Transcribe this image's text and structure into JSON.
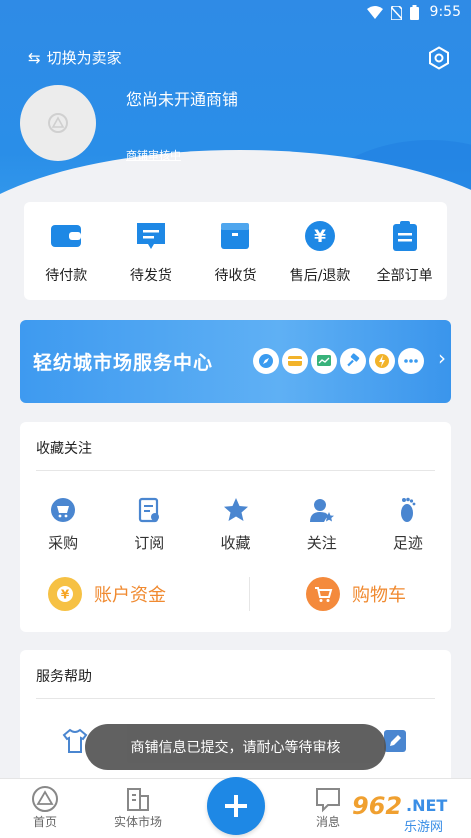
{
  "statusbar": {
    "time": "9:55"
  },
  "header": {
    "switch_label": "切换为卖家",
    "shop_name": "您尚未开通商铺",
    "shop_status": "商铺审核中"
  },
  "orders": [
    {
      "label": "待付款",
      "icon": "wallet-icon"
    },
    {
      "label": "待发货",
      "icon": "message-box-icon"
    },
    {
      "label": "待收货",
      "icon": "box-icon"
    },
    {
      "label": "售后/退款",
      "icon": "yen-icon"
    },
    {
      "label": "全部订单",
      "icon": "clipboard-icon"
    }
  ],
  "banner": {
    "title": "轻纺城市场服务中心"
  },
  "favorites": {
    "title": "收藏关注",
    "items": [
      {
        "label": "采购",
        "icon": "cart-icon"
      },
      {
        "label": "订阅",
        "icon": "subscribe-icon"
      },
      {
        "label": "收藏",
        "icon": "star-icon"
      },
      {
        "label": "关注",
        "icon": "follow-user-icon"
      },
      {
        "label": "足迹",
        "icon": "footprint-icon"
      }
    ],
    "account_fund": "账户资金",
    "shopping_cart": "购物车"
  },
  "help": {
    "title": "服务帮助"
  },
  "toast": "商铺信息已提交，请耐心等待审核",
  "nav": {
    "home": "首页",
    "market": "实体市场",
    "messages": "消息"
  },
  "colors": {
    "primary": "#2f8be6",
    "accent_orange": "#f08a30"
  }
}
